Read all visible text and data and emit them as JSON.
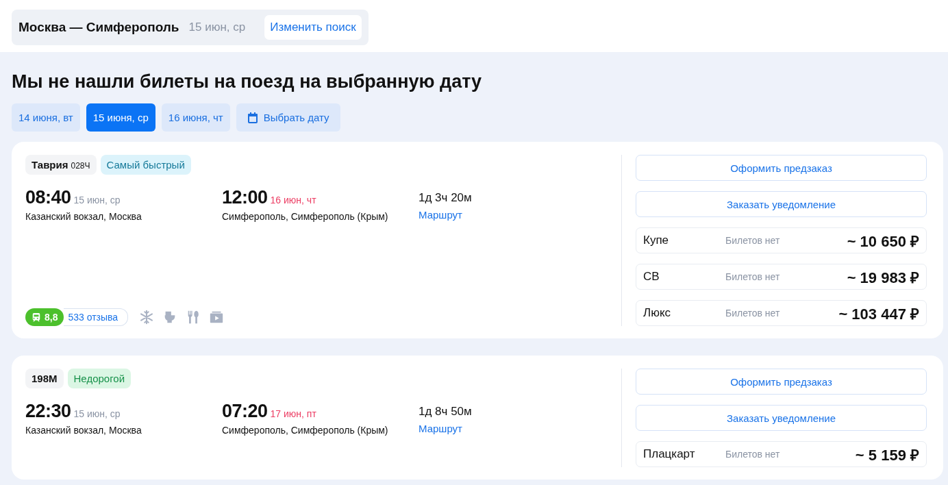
{
  "search_summary": {
    "route": "Москва — Симферополь",
    "date": "15 июн, ср",
    "change_button": "Изменить поиск"
  },
  "heading": "Мы не нашли билеты на поезд на выбранную дату",
  "date_tabs": [
    {
      "label": "14 июня, вт",
      "selected": false
    },
    {
      "label": "15 июня, ср",
      "selected": true
    },
    {
      "label": "16 июня, чт",
      "selected": false
    }
  ],
  "pick_date_button": "Выбрать дату",
  "trains": [
    {
      "name": "Таврия",
      "number": "028Ч",
      "tag": {
        "label": "Самый быстрый",
        "kind": "fastest"
      },
      "departure": {
        "time": "08:40",
        "date": "15 июн, ср",
        "station": "Казанский вокзал, Москва"
      },
      "arrival": {
        "time": "12:00",
        "date": "16 июн, чт",
        "station": "Симферополь, Симферополь (Крым)"
      },
      "duration": "1д 3ч 20м",
      "route_link": "Маршрут",
      "rating": {
        "score": "8,8",
        "reviews": "533 отзыва"
      },
      "amenities": [
        {
          "kind": "snowflake"
        },
        {
          "kind": "toilet"
        },
        {
          "kind": "food"
        },
        {
          "kind": "video"
        }
      ],
      "preorder_button": "Оформить предзаказ",
      "notify_button": "Заказать уведомление",
      "fares": [
        {
          "class": "Купе",
          "status": "Билетов нет",
          "price": "~ 10 650 ₽"
        },
        {
          "class": "СВ",
          "status": "Билетов нет",
          "price": "~ 19 983 ₽"
        },
        {
          "class": "Люкс",
          "status": "Билетов нет",
          "price": "~ 103 447 ₽"
        }
      ]
    },
    {
      "number": "198М",
      "tag": {
        "label": "Недорогой",
        "kind": "cheap"
      },
      "departure": {
        "time": "22:30",
        "date": "15 июн, ср",
        "station": "Казанский вокзал, Москва"
      },
      "arrival": {
        "time": "07:20",
        "date": "17 июн, пт",
        "station": "Симферополь, Симферополь (Крым)"
      },
      "duration": "1д 8ч 50м",
      "route_link": "Маршрут",
      "preorder_button": "Оформить предзаказ",
      "notify_button": "Заказать уведомление",
      "fares": [
        {
          "class": "Плацкарт",
          "status": "Билетов нет",
          "price": "~ 5 159 ₽"
        }
      ]
    }
  ]
}
